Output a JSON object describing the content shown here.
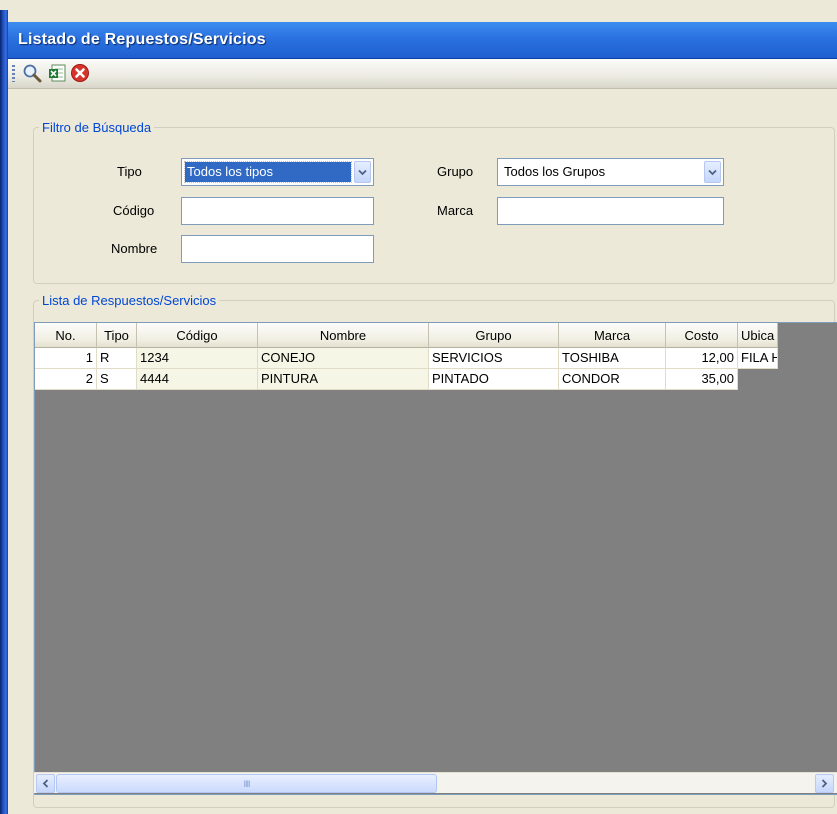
{
  "window": {
    "title": "Listado de Repuestos/Servicios"
  },
  "toolbar": {
    "buttons": [
      {
        "icon": "search-icon"
      },
      {
        "icon": "excel-icon"
      },
      {
        "icon": "close-icon"
      }
    ]
  },
  "filter": {
    "legend": "Filtro de Búsqueda",
    "tipo_label": "Tipo",
    "tipo_value": "Todos los tipos",
    "grupo_label": "Grupo",
    "grupo_value": "Todos los Grupos",
    "codigo_label": "Código",
    "codigo_value": "",
    "marca_label": "Marca",
    "marca_value": "",
    "nombre_label": "Nombre",
    "nombre_value": ""
  },
  "list": {
    "legend": "Lista de Respuestos/Servicios",
    "columns": [
      "No.",
      "Tipo",
      "Código",
      "Nombre",
      "Grupo",
      "Marca",
      "Costo",
      "Ubica"
    ],
    "rows": [
      [
        "1",
        "R",
        "1234",
        "CONEJO",
        "SERVICIOS",
        "TOSHIBA",
        "12,00",
        "FILA H"
      ],
      [
        "2",
        "S",
        "4444",
        "PINTURA",
        "PINTADO",
        "CONDOR",
        "35,00",
        ""
      ]
    ]
  },
  "scrollbar": {
    "thumb_grip": "IIII"
  }
}
